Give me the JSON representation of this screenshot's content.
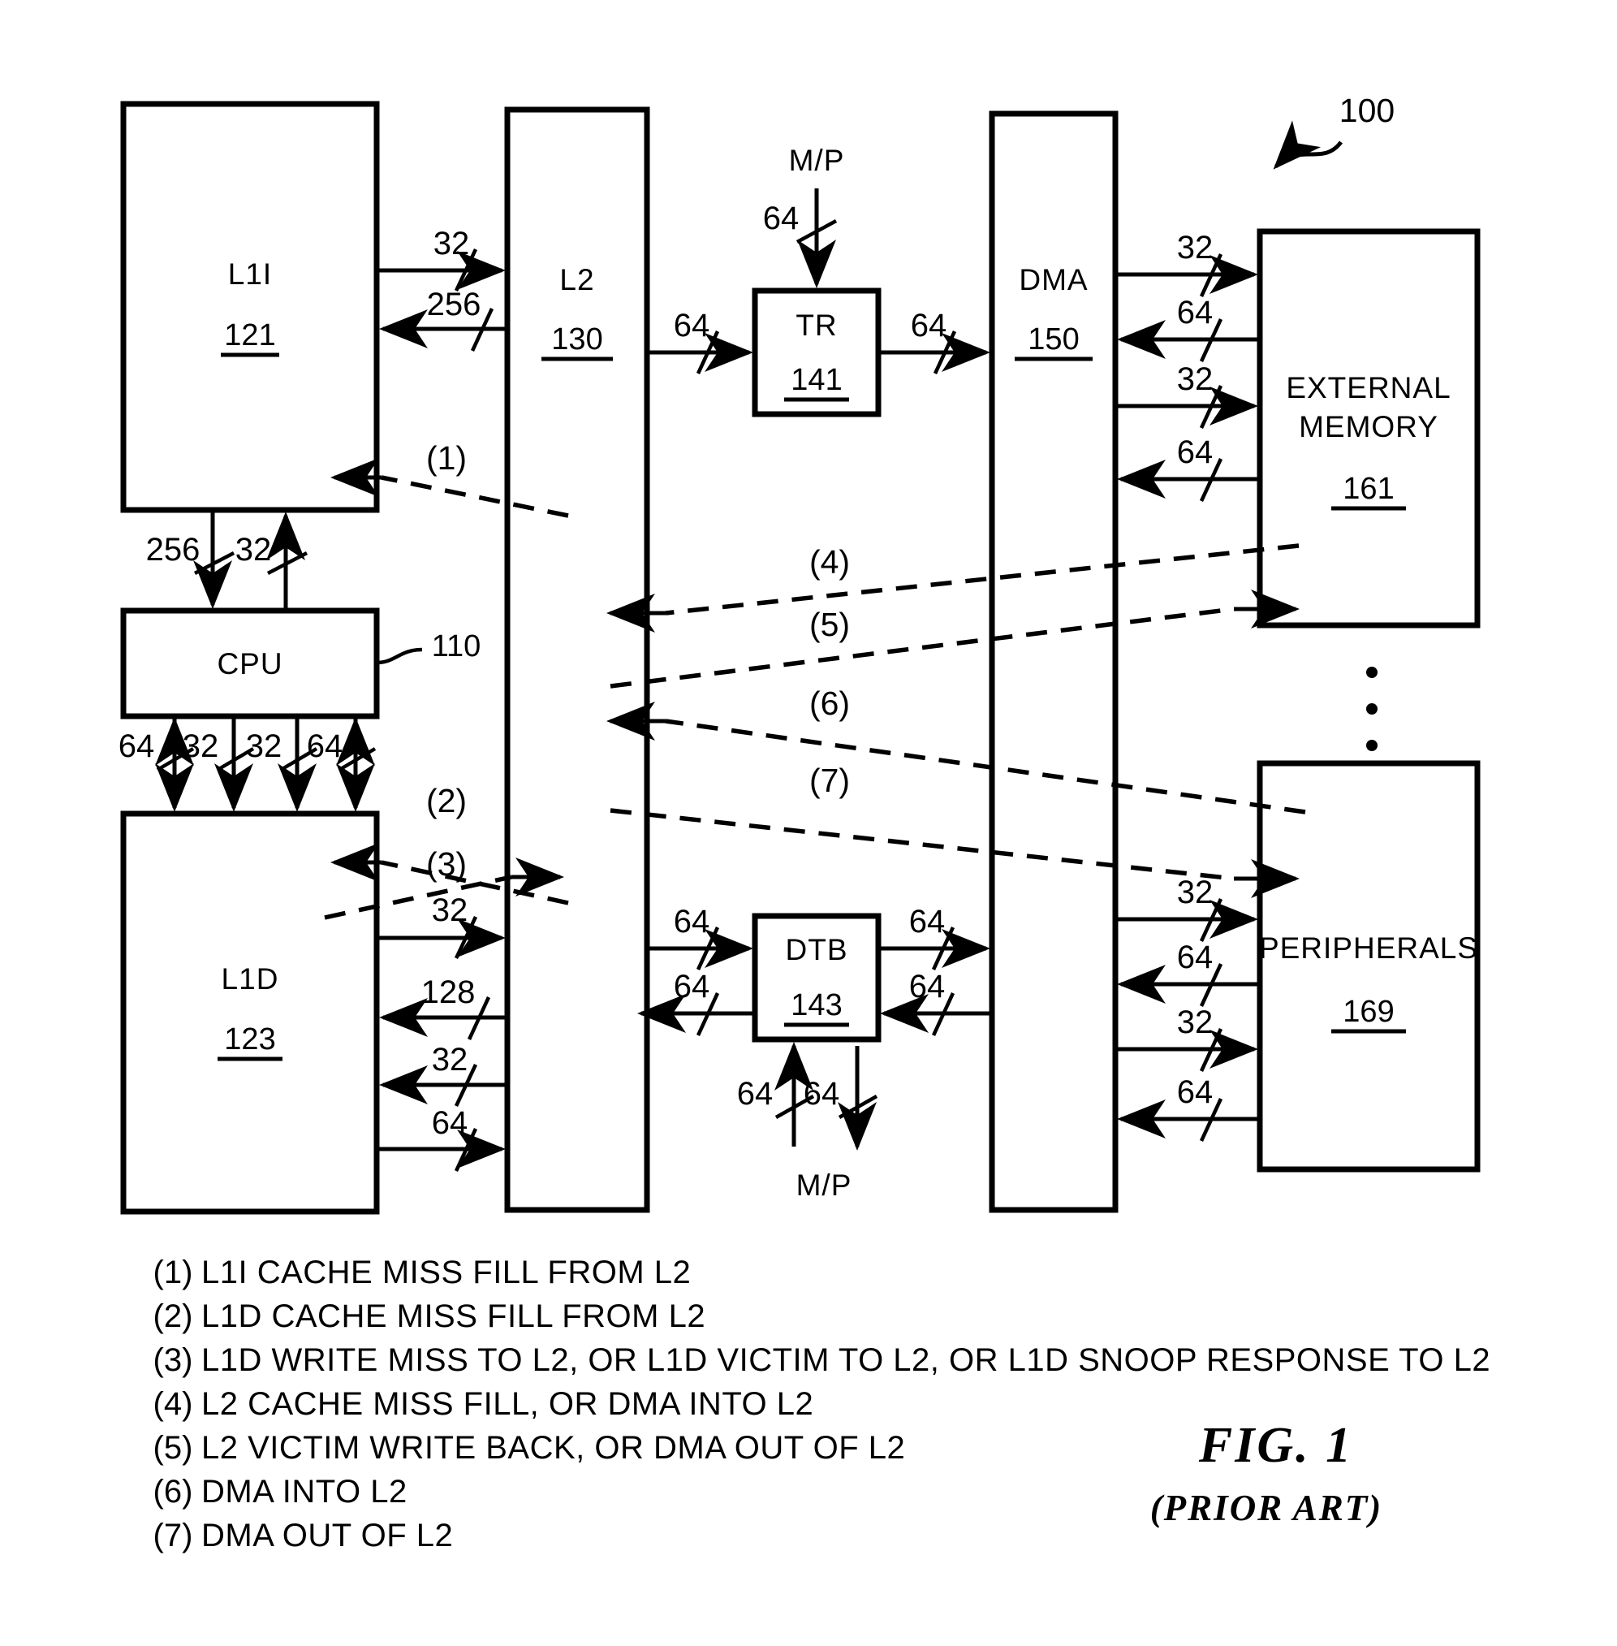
{
  "figure": {
    "caption": "FIG. 1",
    "subcaption": "(PRIOR ART)",
    "system_ref": "100"
  },
  "blocks": {
    "l1i": {
      "name": "L1I",
      "ref": "121"
    },
    "l2": {
      "name": "L2",
      "ref": "130"
    },
    "tr": {
      "name": "TR",
      "ref": "141"
    },
    "dma": {
      "name": "DMA",
      "ref": "150"
    },
    "extmem": {
      "name_line1": "EXTERNAL",
      "name_line2": "MEMORY",
      "ref": "161"
    },
    "cpu": {
      "name": "CPU",
      "ref": "110"
    },
    "l1d": {
      "name": "L1D",
      "ref": "123"
    },
    "dtb": {
      "name": "DTB",
      "ref": "143"
    },
    "periph": {
      "name": "PERIPHERALS",
      "ref": "169"
    }
  },
  "external_ports": {
    "tr_mp": "M/P",
    "tr_mp_width": "64",
    "dtb_mp": "M/P",
    "dtb_mp_in_width": "64",
    "dtb_mp_out_width": "64"
  },
  "buses": {
    "l1i_to_l2": "32",
    "l2_to_l1i": "256",
    "l1i_to_cpu": "256",
    "cpu_to_l1i": "32",
    "cpu_l1d_a": "64",
    "cpu_l1d_b": "32",
    "cpu_l1d_c": "32",
    "cpu_l1d_d": "64",
    "l1d_to_l2": "32",
    "l2_to_l1d_128": "128",
    "l2_to_l1d_32": "32",
    "l1d_to_l2_64": "64",
    "l2_to_tr": "64",
    "tr_to_dma": "64",
    "l2_to_dtb": "64",
    "dtb_to_l2": "64",
    "dtb_to_dma": "64",
    "dma_to_dtb": "64",
    "dma_to_ext_32": "32",
    "ext_to_dma_64": "64",
    "dma_to_ext_32b": "32",
    "ext_to_dma_64b": "64",
    "dma_to_per_32": "32",
    "per_to_dma_64": "64",
    "dma_to_per_32b": "32",
    "per_to_dma_64b": "64"
  },
  "flow_markers": {
    "m1": "(1)",
    "m2": "(2)",
    "m3": "(3)",
    "m4": "(4)",
    "m5": "(5)",
    "m6": "(6)",
    "m7": "(7)"
  },
  "legend": [
    {
      "num": "(1)",
      "text": "L1I CACHE MISS FILL FROM L2"
    },
    {
      "num": "(2)",
      "text": "L1D CACHE MISS FILL FROM L2"
    },
    {
      "num": "(3)",
      "text": "L1D WRITE MISS TO L2, OR L1D VICTIM TO L2, OR L1D SNOOP RESPONSE TO L2"
    },
    {
      "num": "(4)",
      "text": "L2 CACHE MISS FILL, OR DMA INTO L2"
    },
    {
      "num": "(5)",
      "text": "L2 VICTIM WRITE BACK, OR DMA OUT OF L2"
    },
    {
      "num": "(6)",
      "text": "DMA INTO L2"
    },
    {
      "num": "(7)",
      "text": "DMA OUT OF L2"
    }
  ],
  "colors": {
    "ink": "#000000",
    "paper": "#ffffff"
  }
}
